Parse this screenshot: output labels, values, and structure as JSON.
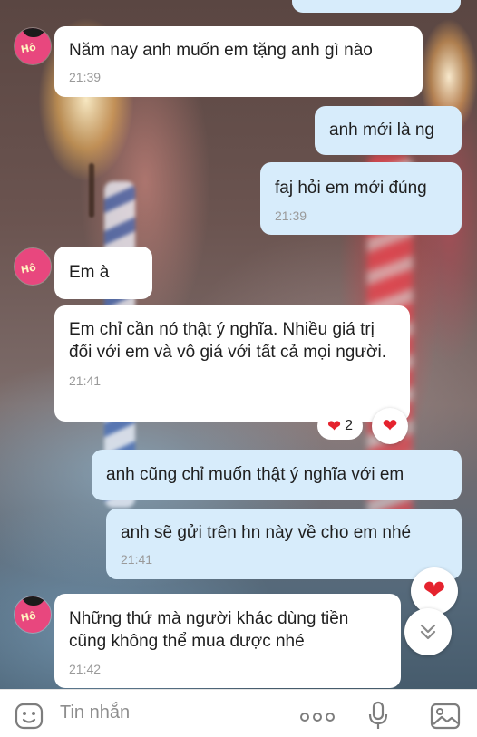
{
  "messages": [
    {
      "side": "in",
      "text": "Năm nay anh muốn em tặng anh gì nào",
      "time": "21:39"
    },
    {
      "side": "out",
      "text": "anh mới là ng",
      "time": ""
    },
    {
      "side": "out",
      "text": "faj hỏi em mới đúng",
      "time": "21:39"
    },
    {
      "side": "in",
      "text": "Em à",
      "time": ""
    },
    {
      "side": "in",
      "text": "Em chỉ cần nó thật ý nghĩa. Nhiều giá trị đối với em và vô giá với tất cả mọi người.",
      "time": "21:41"
    },
    {
      "side": "out",
      "text": "anh cũng chỉ muốn thật ý nghĩa với em",
      "time": ""
    },
    {
      "side": "out",
      "text": "anh sẽ gửi trên hn này về cho em nhé",
      "time": "21:41"
    },
    {
      "side": "in",
      "text": "Những thứ mà người khác dùng tiền cũng không thể mua được nhé",
      "time": "21:42"
    }
  ],
  "reaction": {
    "count": "2",
    "icon": "heart-icon",
    "color": "#e5232e"
  },
  "avatar": {
    "logo_text": "Hô"
  },
  "composer": {
    "placeholder": "Tin nhắn",
    "icons": [
      "sticker-icon",
      "more-icon",
      "microphone-icon",
      "image-icon"
    ]
  },
  "colors": {
    "incoming": "#ffffff",
    "outgoing": "#d7ecfb",
    "accent_heart": "#e5232e",
    "icon_gray": "#8a8a8a"
  }
}
